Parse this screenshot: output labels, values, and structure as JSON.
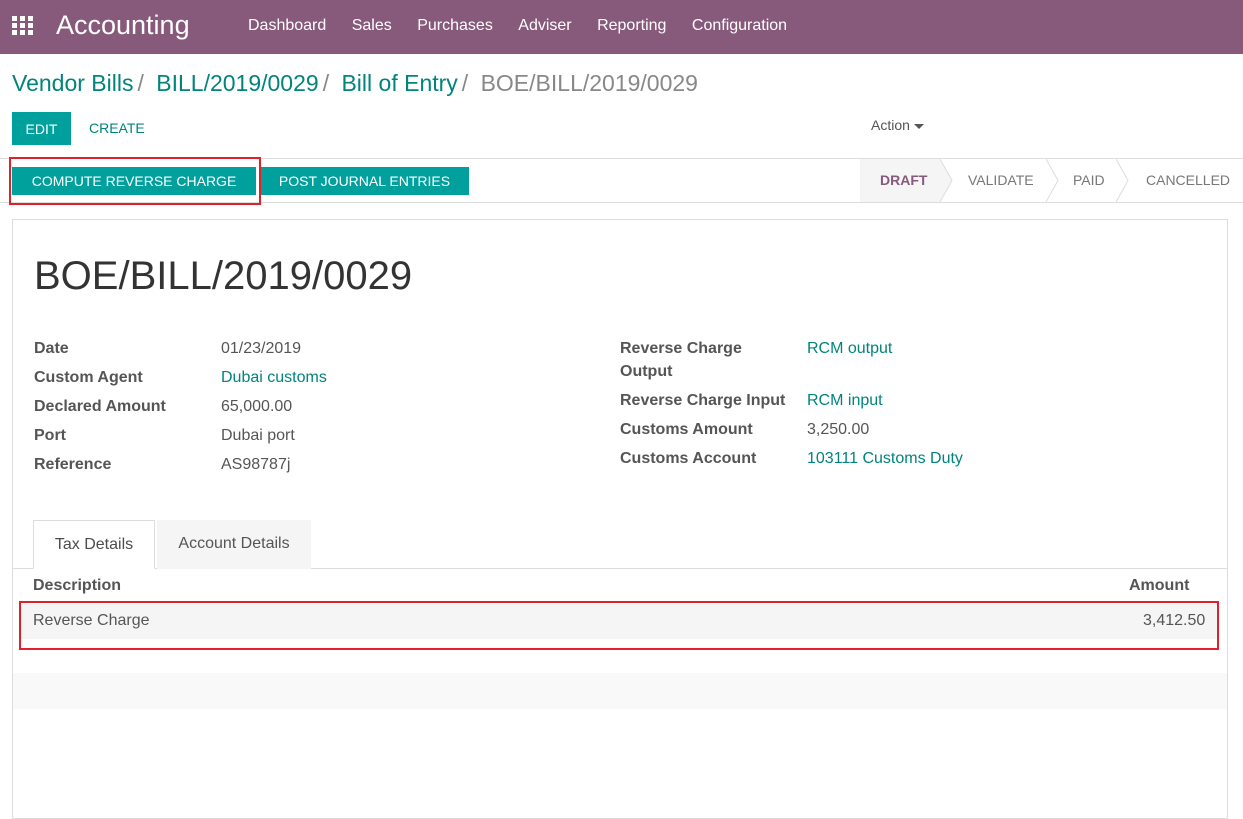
{
  "topbar": {
    "app_title": "Accounting",
    "menu": [
      "Dashboard",
      "Sales",
      "Purchases",
      "Adviser",
      "Reporting",
      "Configuration"
    ],
    "color": "#875a7b",
    "icon": "apps-grid-icon"
  },
  "breadcrumb": {
    "items": [
      "Vendor Bills",
      "BILL/2019/0029",
      "Bill of Entry"
    ],
    "current": "BOE/BILL/2019/0029"
  },
  "control_panel": {
    "edit_label": "EDIT",
    "create_label": "CREATE",
    "action_label": "Action"
  },
  "header_buttons": {
    "compute_reverse_charge": "COMPUTE REVERSE CHARGE",
    "post_journal_entries": "POST JOURNAL ENTRIES"
  },
  "stages": {
    "items": [
      "DRAFT",
      "VALIDATE",
      "PAID",
      "CANCELLED"
    ],
    "active": "DRAFT"
  },
  "form": {
    "title": "BOE/BILL/2019/0029",
    "left": [
      {
        "label": "Date",
        "value": "01/23/2019"
      },
      {
        "label": "Custom Agent",
        "value": "Dubai customs"
      },
      {
        "label": "Declared Amount",
        "value": "65,000.00"
      },
      {
        "label": "Port",
        "value": "Dubai port"
      },
      {
        "label": "Reference",
        "value": "AS98787j"
      }
    ],
    "right": [
      {
        "label": "Reverse Charge Output",
        "value": "RCM output"
      },
      {
        "label": "Reverse Charge Input",
        "value": "RCM input"
      },
      {
        "label": "Customs Amount",
        "value": "3,250.00"
      },
      {
        "label": "Customs Account",
        "value": "103111 Customs Duty"
      }
    ]
  },
  "tabs": [
    "Tax Details",
    "Account Details"
  ],
  "tax_table": {
    "columns": [
      "Description",
      "Amount"
    ],
    "rows": [
      {
        "description": "Reverse Charge",
        "amount": "3,412.50"
      }
    ]
  },
  "colors": {
    "accent": "#00a09d",
    "link": "#00847c",
    "highlight": "#e0202a"
  }
}
